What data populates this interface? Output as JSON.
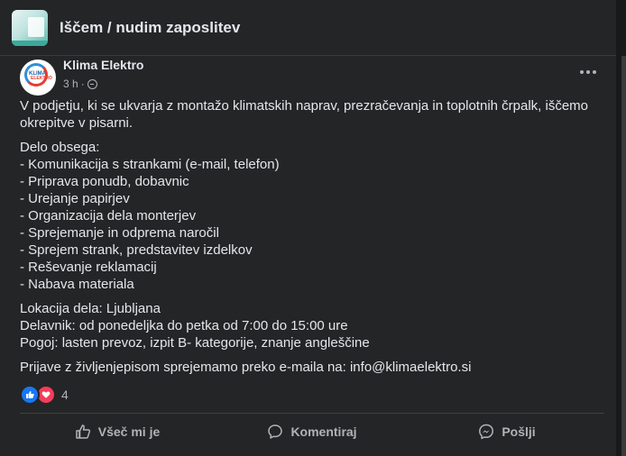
{
  "group": {
    "title": "Iščem / nudim zaposlitev"
  },
  "post": {
    "author": "Klima Elektro",
    "time": "3 h",
    "separator": "·",
    "intro": "V podjetju, ki se ukvarja z montažo klimatskih naprav, prezračevanja in toplotnih črpalk, iščemo okrepitve v pisarni.",
    "scope_heading": "Delo obsega:",
    "scope_items": [
      "- Komunikacija s strankami (e-mail, telefon)",
      "- Priprava ponudb, dobavnic",
      "- Urejanje papirjev",
      "- Organizacija dela monterjev",
      "- Sprejemanje in odprema naročil",
      "- Sprejem strank, predstavitev izdelkov",
      "- Reševanje reklamacij",
      "- Nabava materiala"
    ],
    "location": "Lokacija dela: Ljubljana",
    "workday": "Delavnik: od ponedeljka do petka od 7:00 do 15:00 ure",
    "requirements": "Pogoj: lasten prevoz, izpit B- kategorije, znanje angleščine",
    "apply": "Prijave z življenjepisom sprejemamo preko e-maila na: info@klimaelektro.si",
    "reaction_count": "4"
  },
  "actions": {
    "like": "Všeč mi je",
    "comment": "Komentiraj",
    "share": "Pošlji"
  },
  "icons": {
    "avatar_logo_line1": "KLIMA",
    "avatar_logo_line2": "ELEKTRO"
  },
  "colors": {
    "background": "#18191a",
    "card": "#242526",
    "text_primary": "#e4e6eb",
    "text_secondary": "#b0b3b8",
    "like_blue": "#1877f2",
    "love_red": "#f33e58"
  }
}
